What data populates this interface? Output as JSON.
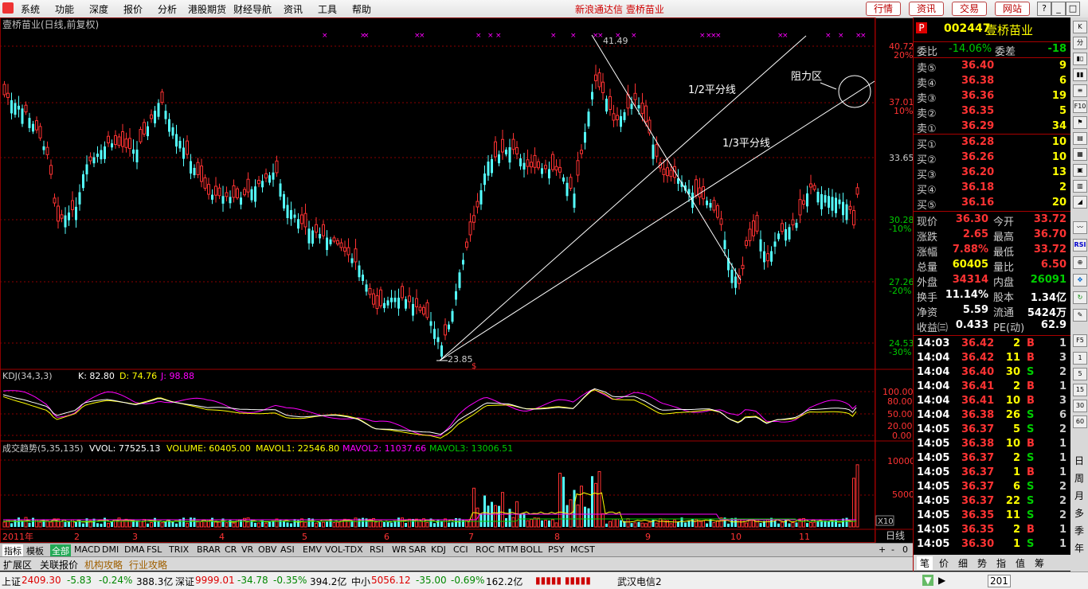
{
  "menubar": {
    "items": [
      "系统",
      "功能",
      "深度",
      "报价",
      "分析",
      "港股期货",
      "财经导航",
      "资讯",
      "工具",
      "帮助"
    ],
    "center_title": "新浪通达信  壹桥苗业",
    "right_buttons": [
      "行情",
      "资讯",
      "交易",
      "网站"
    ],
    "window_buttons": [
      "?",
      "_",
      "□",
      "×"
    ]
  },
  "chart": {
    "title": "壹桥苗业(日线,前复权)",
    "price_labels": [
      {
        "value": "40.72",
        "pct": "20%"
      },
      {
        "value": "37.01",
        "pct": "10%"
      },
      {
        "value": "33.65",
        "pct": ""
      },
      {
        "value": "30.28",
        "pct": "-10%"
      },
      {
        "value": "27.26",
        "pct": "-20%"
      },
      {
        "value": "24.53",
        "pct": "-30%"
      }
    ],
    "high_label": "41.49",
    "low_label": "23.85",
    "annotations": {
      "half_line": "1/2平分线",
      "third_line": "1/3平分线",
      "resistance": "阻力区"
    },
    "month_labels": [
      "2011年",
      "2",
      "3",
      "4",
      "5",
      "6",
      "7",
      "8",
      "9",
      "10",
      "11"
    ],
    "kdj": {
      "title": "KDJ(34,3,3)",
      "k": "K: 82.80",
      "d": "D: 74.76",
      "j": "J: 98.88",
      "axis": [
        "100.00",
        "80.00",
        "50.00",
        "20.00",
        "0.00"
      ]
    },
    "volume": {
      "title": "成交趋势(5,35,135)",
      "vvol": "VVOL: 77525.13",
      "volume": "VOLUME: 60405.00",
      "mavol1": "MAVOL1: 22546.80",
      "mavol2": "MAVOL2: 11037.66",
      "mavol3": "MAVOL3: 13006.51",
      "axis": [
        "10000",
        "5000"
      ],
      "unit": "X10",
      "period": "日线"
    },
    "colors": {
      "up": "#ff3232",
      "down": "#54ffff",
      "kline": "#ffffff",
      "dline": "#ffff00",
      "jline": "#ff00ff",
      "grid": "#8b0000"
    }
  },
  "quote": {
    "code": "002447",
    "name": "壹桥苗业",
    "weibi_label": "委比",
    "weibi": "-14.06%",
    "weicha_label": "委差",
    "weicha": "-18",
    "sell": [
      {
        "label": "卖⑤",
        "price": "36.40",
        "vol": "9"
      },
      {
        "label": "卖④",
        "price": "36.38",
        "vol": "6"
      },
      {
        "label": "卖③",
        "price": "36.36",
        "vol": "19"
      },
      {
        "label": "卖②",
        "price": "36.35",
        "vol": "5"
      },
      {
        "label": "卖①",
        "price": "36.29",
        "vol": "34"
      }
    ],
    "buy": [
      {
        "label": "买①",
        "price": "36.28",
        "vol": "10"
      },
      {
        "label": "买②",
        "price": "36.26",
        "vol": "10"
      },
      {
        "label": "买③",
        "price": "36.20",
        "vol": "13"
      },
      {
        "label": "买④",
        "price": "36.18",
        "vol": "2"
      },
      {
        "label": "买⑤",
        "price": "36.16",
        "vol": "20"
      }
    ],
    "stats": [
      [
        "现价",
        "36.30",
        "今开",
        "33.72"
      ],
      [
        "涨跌",
        "2.65",
        "最高",
        "36.70"
      ],
      [
        "涨幅",
        "7.88%",
        "最低",
        "33.72"
      ],
      [
        "总量",
        "60405",
        "量比",
        "6.50"
      ],
      [
        "外盘",
        "34314",
        "内盘",
        "26091"
      ],
      [
        "换手",
        "11.14%",
        "股本",
        "1.34亿"
      ],
      [
        "净资",
        "5.59",
        "流通",
        "5424万"
      ],
      [
        "收益㈢",
        "0.433",
        "PE(动)",
        "62.9"
      ]
    ],
    "ticks": [
      [
        "14:03",
        "36.42",
        "2",
        "B",
        "1"
      ],
      [
        "14:04",
        "36.42",
        "11",
        "B",
        "3"
      ],
      [
        "14:04",
        "36.40",
        "30",
        "S",
        "2"
      ],
      [
        "14:04",
        "36.41",
        "2",
        "B",
        "1"
      ],
      [
        "14:04",
        "36.41",
        "10",
        "B",
        "3"
      ],
      [
        "14:04",
        "36.38",
        "26",
        "S",
        "6"
      ],
      [
        "14:05",
        "36.37",
        "5",
        "S",
        "2"
      ],
      [
        "14:05",
        "36.38",
        "10",
        "B",
        "1"
      ],
      [
        "14:05",
        "36.37",
        "2",
        "S",
        "1"
      ],
      [
        "14:05",
        "36.37",
        "1",
        "B",
        "1"
      ],
      [
        "14:05",
        "36.37",
        "6",
        "S",
        "2"
      ],
      [
        "14:05",
        "36.37",
        "22",
        "S",
        "2"
      ],
      [
        "14:05",
        "36.35",
        "11",
        "S",
        "2"
      ],
      [
        "14:05",
        "36.35",
        "2",
        "B",
        "1"
      ],
      [
        "14:05",
        "36.30",
        "1",
        "S",
        "1"
      ]
    ],
    "bottom_tabs": [
      "笔",
      "价",
      "细",
      "势",
      "指",
      "值",
      "筹"
    ]
  },
  "toolbar_right": {
    "icons": [
      "K",
      "分",
      "F10",
      "F5",
      "RSI",
      "全"
    ],
    "vertical": [
      "日",
      "周",
      "月",
      "多",
      "季",
      "年"
    ]
  },
  "tabs1": [
    "指标",
    "模板",
    "全部",
    "MACD",
    "DMI",
    "DMA",
    "FSL",
    "TRIX",
    "BRAR",
    "CR",
    "VR",
    "OBV",
    "ASI",
    "EMV",
    "VOL-TDX",
    "RSI",
    "WR",
    "SAR",
    "KDJ",
    "CCI",
    "ROC",
    "MTM",
    "BOLL",
    "PSY",
    "MCST"
  ],
  "tabs2": [
    "扩展区",
    "关联报价",
    "机构攻略",
    "行业攻略"
  ],
  "status": {
    "sh_label": "上证",
    "sh_value": "2409.30",
    "sh_chg": "-5.83",
    "sh_pct": "-0.24%",
    "sh_amt": "388.3亿",
    "sz_label": "深证",
    "sz_value": "9999.01",
    "sz_chg": "-34.78",
    "sz_pct": "-0.35%",
    "sz_amt": "394.2亿",
    "zx_label": "中小",
    "zx_value": "5056.12",
    "zx_chg": "-35.00",
    "zx_pct": "-0.69%",
    "zx_amt": "162.2亿",
    "server": "武汉电信2",
    "clock": "201"
  }
}
